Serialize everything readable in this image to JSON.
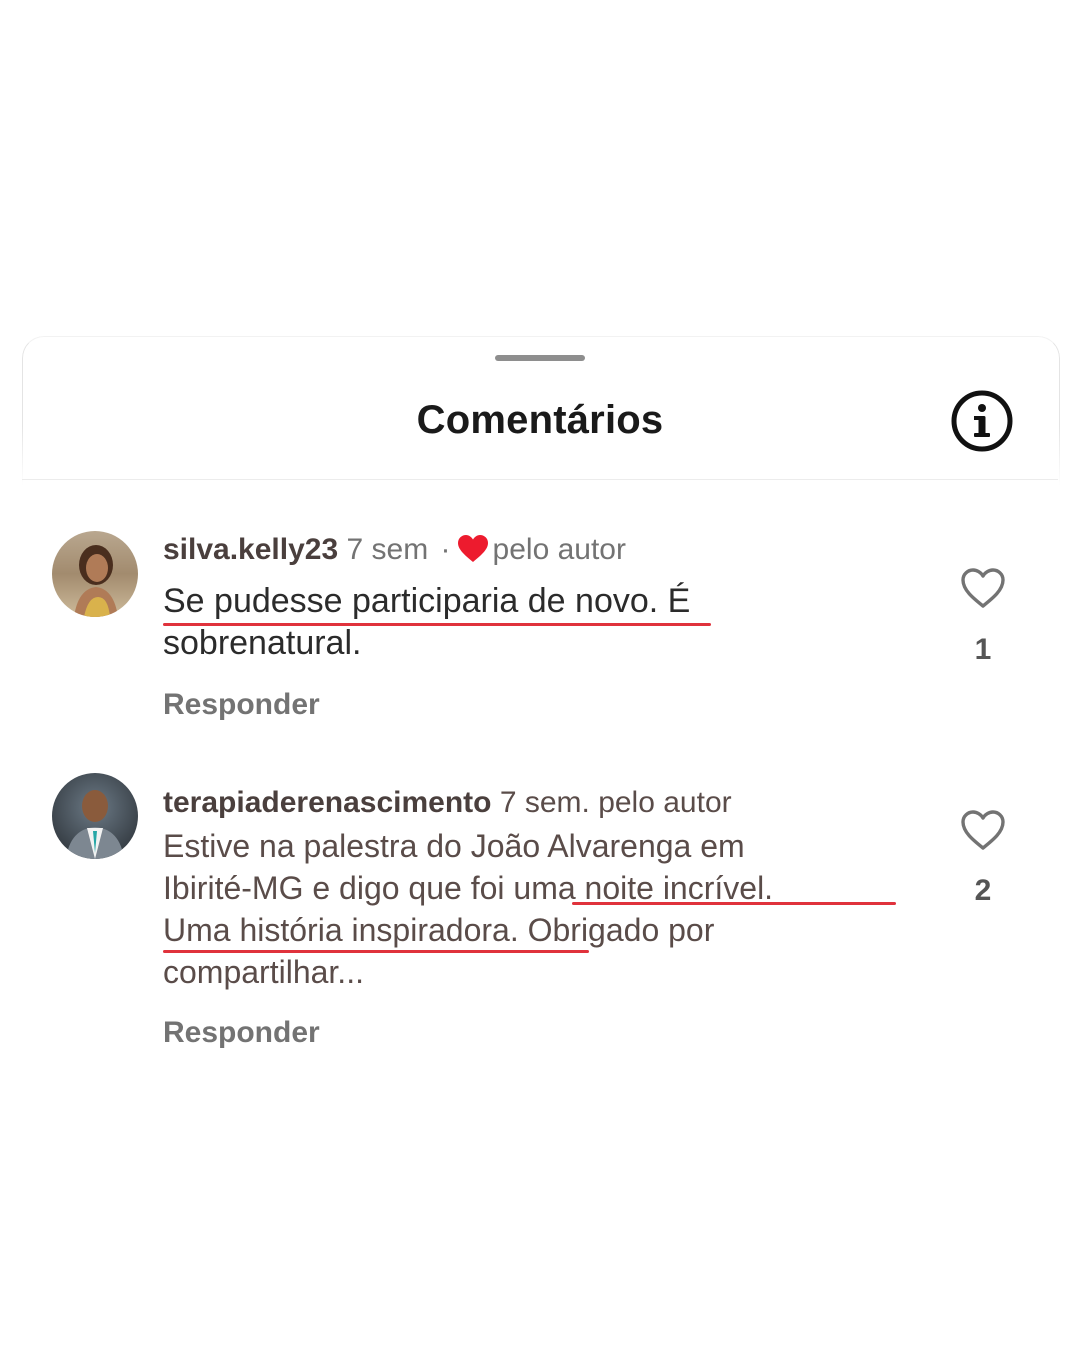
{
  "header": {
    "title": "Comentários",
    "info_icon": "info-icon"
  },
  "comments": [
    {
      "username": "silva.kelly23",
      "time": "7 sem",
      "separator": "·",
      "liked_by_author_icon": "heart-filled-icon",
      "liked_by_author": "pelo autor",
      "text_line1": "Se pudesse participaria de novo. É",
      "text_line2": "sobrenatural.",
      "reply_label": "Responder",
      "likes": "1",
      "avatar_icon": "avatar-photo"
    },
    {
      "username": "terapiaderenascimento",
      "time": "7 sem.",
      "liked_by_author": "pelo autor",
      "text_line1": "Estive na palestra do João Alvarenga em",
      "text_line2": "Ibirité-MG e digo que foi uma noite incrível.",
      "text_line3": "Uma história inspiradora. Obrigado por",
      "text_line4": "compartilhar...",
      "reply_label": "Responder",
      "likes": "2",
      "avatar_icon": "avatar-photo"
    }
  ],
  "colors": {
    "highlight_underline": "#e0323c",
    "heart_red": "#ed1b2e",
    "text_muted": "#737373"
  }
}
